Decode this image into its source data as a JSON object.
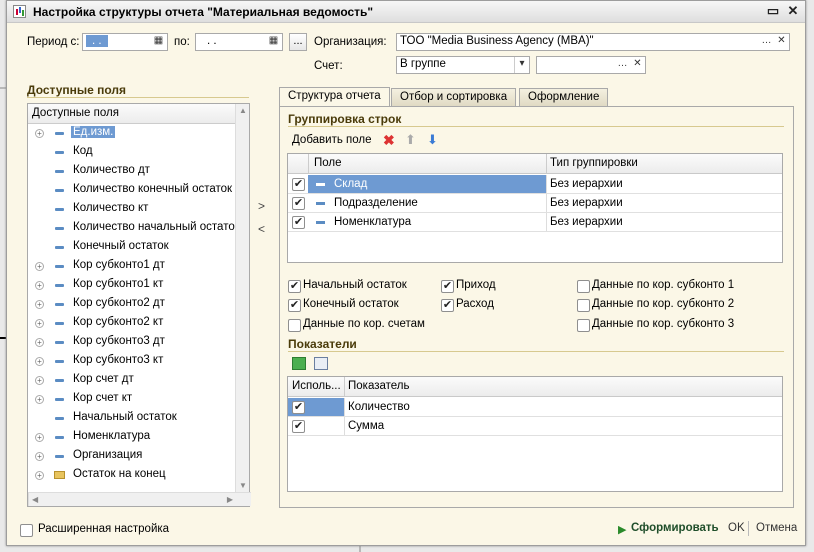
{
  "window": {
    "title": "Настройка структуры отчета \"Материальная ведомость\""
  },
  "period": {
    "label_from": "Период с:",
    "from_value": ". .",
    "label_to": "по:",
    "to_value": ". .",
    "ellipsis": "..."
  },
  "organization": {
    "label": "Организация:",
    "value": "ТОО \"Media Business Agency (MBA)\""
  },
  "account": {
    "label": "Счет:",
    "value": "В группе",
    "second_value": ""
  },
  "available_fields": {
    "section_title": "Доступные поля",
    "header": "Доступные поля",
    "items": [
      {
        "label": "Ед.изм.",
        "expandable": true,
        "icon": "dash",
        "selected": true
      },
      {
        "label": "Код",
        "expandable": false,
        "icon": "dash"
      },
      {
        "label": "Количество дт",
        "expandable": false,
        "icon": "dash"
      },
      {
        "label": "Количество конечный остаток",
        "expandable": false,
        "icon": "dash"
      },
      {
        "label": "Количество кт",
        "expandable": false,
        "icon": "dash"
      },
      {
        "label": "Количество начальный остаток",
        "expandable": false,
        "icon": "dash"
      },
      {
        "label": "Конечный остаток",
        "expandable": false,
        "icon": "dash"
      },
      {
        "label": "Кор субконто1 дт",
        "expandable": true,
        "icon": "dash"
      },
      {
        "label": "Кор субконто1 кт",
        "expandable": true,
        "icon": "dash"
      },
      {
        "label": "Кор субконто2 дт",
        "expandable": true,
        "icon": "dash"
      },
      {
        "label": "Кор субконто2 кт",
        "expandable": true,
        "icon": "dash"
      },
      {
        "label": "Кор субконто3 дт",
        "expandable": true,
        "icon": "dash"
      },
      {
        "label": "Кор субконто3 кт",
        "expandable": true,
        "icon": "dash"
      },
      {
        "label": "Кор счет дт",
        "expandable": true,
        "icon": "dash"
      },
      {
        "label": "Кор счет кт",
        "expandable": true,
        "icon": "dash"
      },
      {
        "label": "Начальный остаток",
        "expandable": false,
        "icon": "dash"
      },
      {
        "label": "Номенклатура",
        "expandable": true,
        "icon": "dash"
      },
      {
        "label": "Организация",
        "expandable": true,
        "icon": "dash"
      },
      {
        "label": "Остаток на конец",
        "expandable": true,
        "icon": "folder"
      }
    ]
  },
  "move_buttons": {
    "right": ">",
    "left": "<"
  },
  "tabs": [
    "Структура отчета",
    "Отбор и сортировка",
    "Оформление"
  ],
  "grouping": {
    "section_title": "Группировка строк",
    "add_field": "Добавить поле",
    "columns": [
      "Поле",
      "Тип группировки"
    ],
    "rows": [
      {
        "checked": true,
        "field": "Склад",
        "type": "Без иерархии",
        "selected": true
      },
      {
        "checked": true,
        "field": "Подразделение",
        "type": "Без иерархии"
      },
      {
        "checked": true,
        "field": "Номенклатура",
        "type": "Без иерархии"
      }
    ]
  },
  "options": [
    {
      "label": "Начальный остаток",
      "checked": true
    },
    {
      "label": "Приход",
      "checked": true
    },
    {
      "label": "Данные по кор. субконто 1",
      "checked": false
    },
    {
      "label": "Конечный остаток",
      "checked": true
    },
    {
      "label": "Расход",
      "checked": true
    },
    {
      "label": "Данные по кор. субконто 2",
      "checked": false
    },
    {
      "label": "Данные по кор. счетам",
      "checked": false
    },
    {
      "label": "Данные по кор. субконто 3",
      "checked": false
    }
  ],
  "indicators": {
    "section_title": "Показатели",
    "columns": [
      "Исполь...",
      "Показатель"
    ],
    "rows": [
      {
        "checked": true,
        "name": "Количество"
      },
      {
        "checked": true,
        "name": "Сумма"
      }
    ]
  },
  "footer": {
    "advanced": "Расширенная настройка",
    "generate": "Сформировать",
    "ok": "OK",
    "cancel": "Отмена"
  },
  "colors": {
    "accent": "#6e9ad2",
    "section": "#4a3b0a",
    "window_bg": "#fbf7e7",
    "generate": "#2a8a2a"
  }
}
